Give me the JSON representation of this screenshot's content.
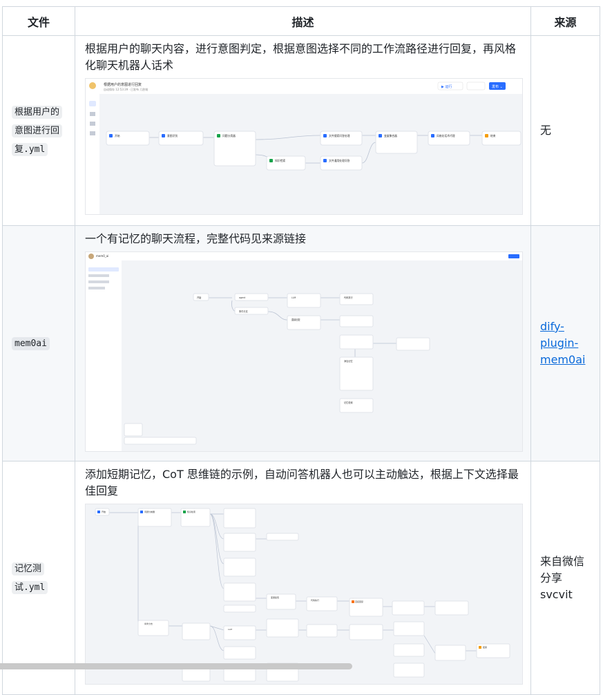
{
  "table": {
    "headers": [
      "文件",
      "描述",
      "来源"
    ],
    "rows": [
      {
        "file_parts": [
          "根据用户的",
          "意图进行回",
          "复",
          ".yml"
        ],
        "desc": "根据用户的聊天内容，进行意图判定，根据意图选择不同的工作流路径进行回复，再风格化聊天机器人话术",
        "source_text": "无",
        "shot": {
          "title": "根据用户的意图进行回复",
          "subtitle": "自动保存 12:53:39 · 已发布 几秒前",
          "run": "▶ 运行",
          "publish": "发布 ⌄",
          "nodes": [
            "开始",
            "意图识别",
            "问题分类器",
            "文件搜索问答处理",
            "变量聚合器",
            "风格化话术代理",
            "结束",
            "知识检索",
            "文件通用处理问答"
          ]
        }
      },
      {
        "file_parts": [
          "mem0ai"
        ],
        "desc": "一个有记忆的聊天流程，完整代码见来源链接",
        "source_link": "dify-plugin-mem0ai",
        "shot": {
          "title": "mem0_ai",
          "nodes": [
            "开始",
            "agent",
            "条件分支",
            "LLM",
            "直接回复",
            "代码执行",
            "添加记忆",
            "记忆检索"
          ]
        }
      },
      {
        "file_parts": [
          "记忆测",
          "试",
          ".yml"
        ],
        "desc": "添加短期记忆，CoT 思维链的示例，自动问答机器人也可以主动触达，根据上下文选择最佳回复",
        "source_lines": [
          "来自微信",
          "分享",
          "svcvit"
        ],
        "shot": {
          "nodes": [
            "开始",
            "问题分类器",
            "知识检索",
            "条件分支",
            "LLM",
            "变量赋值",
            "代码执行",
            "直接回复",
            "结束"
          ]
        }
      }
    ]
  },
  "colors": {
    "link": "#0969da",
    "border": "#d0d7de",
    "code_bg": "#e8eaed",
    "accent": "#296dff"
  }
}
